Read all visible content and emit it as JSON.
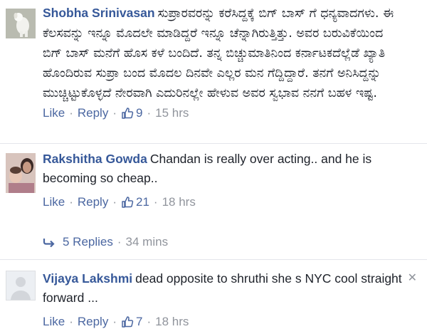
{
  "comments": [
    {
      "author": "Shobha Srinivasan",
      "text": "ಸುಪ್ರಾರವರನ್ನು ಕರೆಸಿದ್ದಕ್ಕೆ ಬಿಗ್ ಬಾಸ್ ಗೆ ಧನ್ಯವಾದಗಳು. ಈ ಕೆಲಸವನ್ನು ಇನ್ನೂ ಮೊದಲೇ ಮಾಡಿದ್ದರೆ ಇನ್ನೂ ಚೆನ್ನಾಗಿರುತ್ತಿತ್ತು. ಅವರ ಬರುವಿಕೆಯಿಂದ ಬಿಗ್ ಬಾಸ್ ಮನೆಗೆ ಹೊಸ ಕಳೆ ಬಂದಿದೆ. ತನ್ನ ಬಿಚ್ಚುಮಾತಿನಿಂದ ಕರ್ನಾಟಕದೆಲ್ಲೆಡೆ ಖ್ಯಾತಿ ಹೊಂದಿರುವ ಸುಪ್ರಾ ಬಂದ ಮೊದಲ ದಿನವೇ ಎಲ್ಲರ ಮನ ಗೆದ್ದಿದ್ದಾರೆ. ತನಗೆ ಅನಿಸಿದ್ದನ್ನು ಮುಚ್ಚಿಟ್ಟುಕೊಳ್ಳದೆ ನೇರವಾಗಿ ಎದುರಿನಲ್ಲೇ ಹೇಳುವ ಅವರ ಸ್ವಭಾವ ನನಗೆ ಬಹಳ ಇಷ್ಟ.",
      "like_label": "Like",
      "reply_label": "Reply",
      "likes": "9",
      "time": "15 hrs"
    },
    {
      "author": "Rakshitha Gowda",
      "text": "Chandan is really over acting.. and he is becoming so cheap..",
      "like_label": "Like",
      "reply_label": "Reply",
      "likes": "21",
      "time": "18 hrs",
      "replies_label": "5 Replies",
      "replies_time": "34 mins"
    },
    {
      "author": "Vijaya Lakshmi",
      "text": "dead opposite to shruthi she s NYC cool straight forward ...",
      "like_label": "Like",
      "reply_label": "Reply",
      "likes": "7",
      "time": "18 hrs"
    }
  ],
  "colors": {
    "author": "#365899",
    "link": "#4b67a1",
    "meta": "#90949c",
    "divider": "#e4e6eb"
  }
}
